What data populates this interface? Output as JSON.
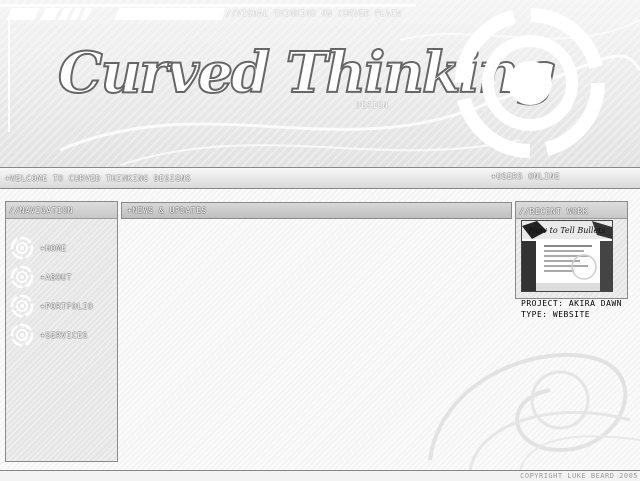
{
  "header": {
    "tagline": "//Visual thinking on curved plain",
    "logo_title": "Curved Thinking",
    "logo_subtitle": "Design"
  },
  "welcome_bar": {
    "welcome_text": "+Welcome to Curved Thinking Designs",
    "users_online": "+Users Online"
  },
  "navigation": {
    "title": "//Navigation",
    "items": [
      {
        "label": "+Home",
        "icon": "target-icon"
      },
      {
        "label": "+About",
        "icon": "target-icon"
      },
      {
        "label": "+Portfolio",
        "icon": "target-icon"
      },
      {
        "label": "+Services",
        "icon": "target-icon"
      }
    ]
  },
  "news": {
    "title": "+News & Updates"
  },
  "recent_work": {
    "title": "//Recent Work",
    "thumbnail_title": "How to Tell Bullets",
    "project_label": "Project: Akira Dawn",
    "type_label": "Type: Website"
  },
  "footer": {
    "copyright": "Copyright Luke Beard 2005"
  },
  "colors": {
    "background": "#fafafa",
    "panel": "#e6e6e6",
    "border": "#8a8a8a",
    "text_dark": "#333333"
  }
}
